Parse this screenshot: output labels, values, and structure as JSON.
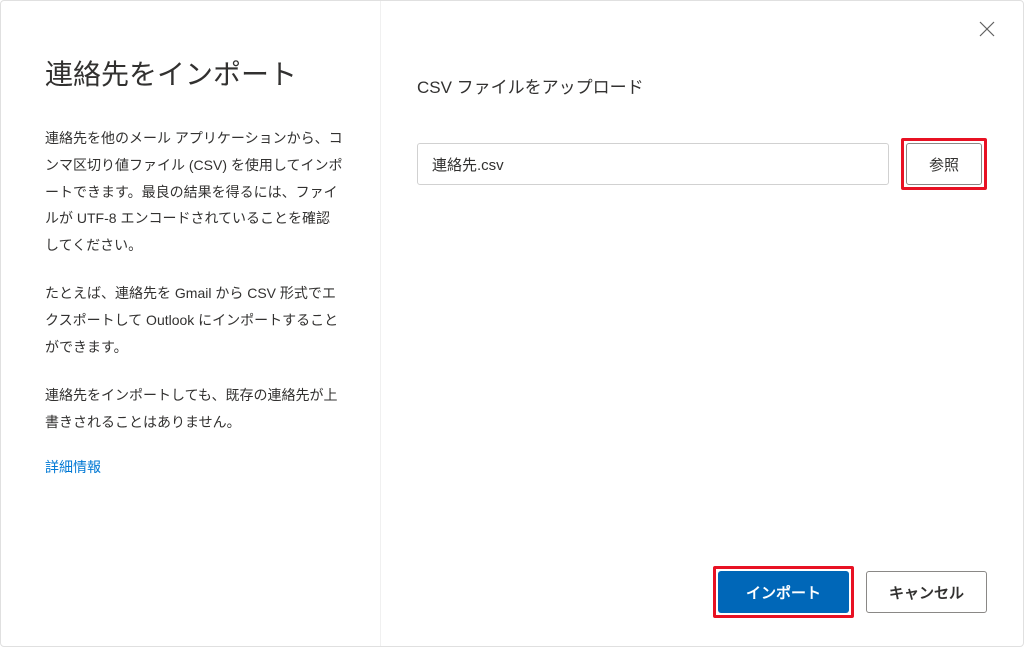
{
  "dialog": {
    "title": "連絡先をインポート",
    "paragraph1": "連絡先を他のメール アプリケーションから、コンマ区切り値ファイル (CSV) を使用してインポートできます。最良の結果を得るには、ファイルが UTF-8 エンコードされていることを確認してください。",
    "paragraph2": "たとえば、連絡先を Gmail から CSV 形式でエクスポートして Outlook にインポートすることができます。",
    "paragraph3": "連絡先をインポートしても、既存の連絡先が上書きされることはありません。",
    "more_info_label": "詳細情報"
  },
  "upload": {
    "title": "CSV ファイルをアップロード",
    "filename": "連絡先.csv",
    "browse_label": "参照"
  },
  "footer": {
    "import_label": "インポート",
    "cancel_label": "キャンセル"
  }
}
